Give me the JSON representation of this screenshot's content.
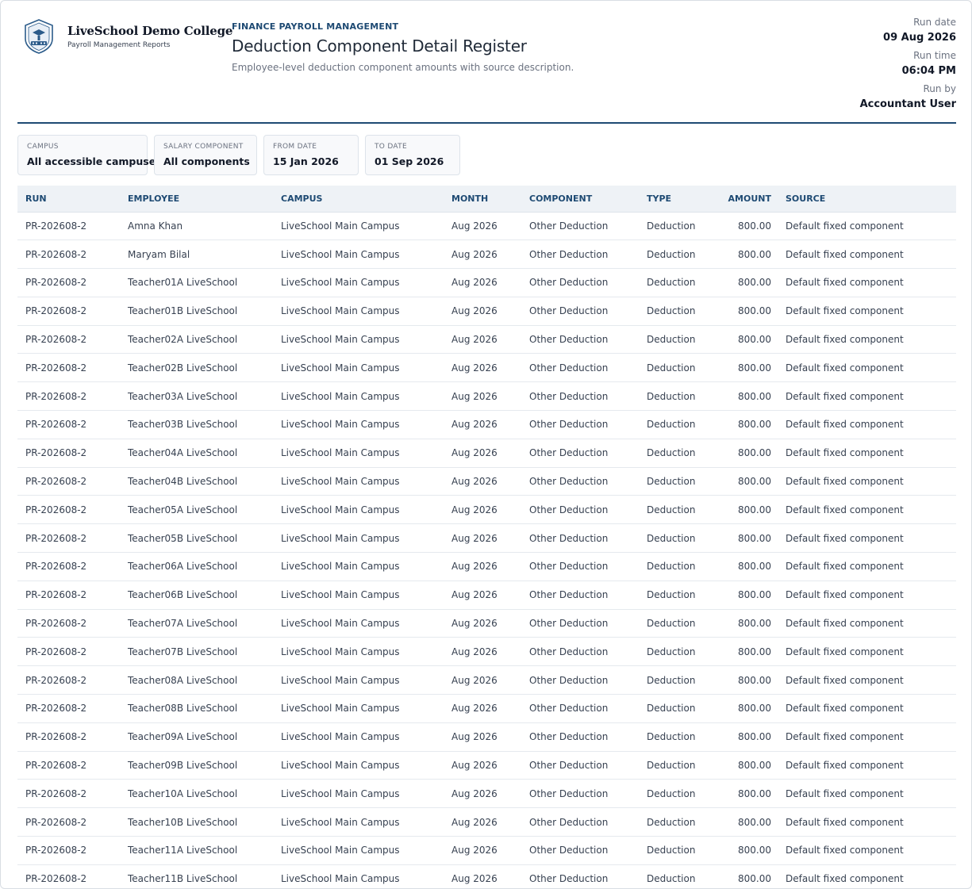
{
  "brand": {
    "college_name": "LiveSchool Demo College",
    "subtitle": "Payroll Management Reports",
    "logo_icon": "school-crest-icon"
  },
  "report": {
    "eyebrow": "FINANCE PAYROLL MANAGEMENT",
    "title": "Deduction Component Detail Register",
    "description": "Employee-level deduction component amounts with source description."
  },
  "meta": {
    "run_date_label": "Run date",
    "run_date": "09 Aug 2026",
    "run_time_label": "Run time",
    "run_time": "06:04 PM",
    "run_by_label": "Run by",
    "run_by": "Accountant User"
  },
  "filters": [
    {
      "label": "CAMPUS",
      "value": "All accessible campuses"
    },
    {
      "label": "SALARY COMPONENT",
      "value": "All components"
    },
    {
      "label": "FROM DATE",
      "value": "15 Jan 2026"
    },
    {
      "label": "TO DATE",
      "value": "01 Sep 2026"
    }
  ],
  "table": {
    "columns": [
      "RUN",
      "EMPLOYEE",
      "CAMPUS",
      "MONTH",
      "COMPONENT",
      "TYPE",
      "AMOUNT",
      "SOURCE"
    ],
    "rows": [
      [
        "PR-202608-2",
        "Amna Khan",
        "LiveSchool Main Campus",
        "Aug 2026",
        "Other Deduction",
        "Deduction",
        "800.00",
        "Default fixed component"
      ],
      [
        "PR-202608-2",
        "Maryam Bilal",
        "LiveSchool Main Campus",
        "Aug 2026",
        "Other Deduction",
        "Deduction",
        "800.00",
        "Default fixed component"
      ],
      [
        "PR-202608-2",
        "Teacher01A LiveSchool",
        "LiveSchool Main Campus",
        "Aug 2026",
        "Other Deduction",
        "Deduction",
        "800.00",
        "Default fixed component"
      ],
      [
        "PR-202608-2",
        "Teacher01B LiveSchool",
        "LiveSchool Main Campus",
        "Aug 2026",
        "Other Deduction",
        "Deduction",
        "800.00",
        "Default fixed component"
      ],
      [
        "PR-202608-2",
        "Teacher02A LiveSchool",
        "LiveSchool Main Campus",
        "Aug 2026",
        "Other Deduction",
        "Deduction",
        "800.00",
        "Default fixed component"
      ],
      [
        "PR-202608-2",
        "Teacher02B LiveSchool",
        "LiveSchool Main Campus",
        "Aug 2026",
        "Other Deduction",
        "Deduction",
        "800.00",
        "Default fixed component"
      ],
      [
        "PR-202608-2",
        "Teacher03A LiveSchool",
        "LiveSchool Main Campus",
        "Aug 2026",
        "Other Deduction",
        "Deduction",
        "800.00",
        "Default fixed component"
      ],
      [
        "PR-202608-2",
        "Teacher03B LiveSchool",
        "LiveSchool Main Campus",
        "Aug 2026",
        "Other Deduction",
        "Deduction",
        "800.00",
        "Default fixed component"
      ],
      [
        "PR-202608-2",
        "Teacher04A LiveSchool",
        "LiveSchool Main Campus",
        "Aug 2026",
        "Other Deduction",
        "Deduction",
        "800.00",
        "Default fixed component"
      ],
      [
        "PR-202608-2",
        "Teacher04B LiveSchool",
        "LiveSchool Main Campus",
        "Aug 2026",
        "Other Deduction",
        "Deduction",
        "800.00",
        "Default fixed component"
      ],
      [
        "PR-202608-2",
        "Teacher05A LiveSchool",
        "LiveSchool Main Campus",
        "Aug 2026",
        "Other Deduction",
        "Deduction",
        "800.00",
        "Default fixed component"
      ],
      [
        "PR-202608-2",
        "Teacher05B LiveSchool",
        "LiveSchool Main Campus",
        "Aug 2026",
        "Other Deduction",
        "Deduction",
        "800.00",
        "Default fixed component"
      ],
      [
        "PR-202608-2",
        "Teacher06A LiveSchool",
        "LiveSchool Main Campus",
        "Aug 2026",
        "Other Deduction",
        "Deduction",
        "800.00",
        "Default fixed component"
      ],
      [
        "PR-202608-2",
        "Teacher06B LiveSchool",
        "LiveSchool Main Campus",
        "Aug 2026",
        "Other Deduction",
        "Deduction",
        "800.00",
        "Default fixed component"
      ],
      [
        "PR-202608-2",
        "Teacher07A LiveSchool",
        "LiveSchool Main Campus",
        "Aug 2026",
        "Other Deduction",
        "Deduction",
        "800.00",
        "Default fixed component"
      ],
      [
        "PR-202608-2",
        "Teacher07B LiveSchool",
        "LiveSchool Main Campus",
        "Aug 2026",
        "Other Deduction",
        "Deduction",
        "800.00",
        "Default fixed component"
      ],
      [
        "PR-202608-2",
        "Teacher08A LiveSchool",
        "LiveSchool Main Campus",
        "Aug 2026",
        "Other Deduction",
        "Deduction",
        "800.00",
        "Default fixed component"
      ],
      [
        "PR-202608-2",
        "Teacher08B LiveSchool",
        "LiveSchool Main Campus",
        "Aug 2026",
        "Other Deduction",
        "Deduction",
        "800.00",
        "Default fixed component"
      ],
      [
        "PR-202608-2",
        "Teacher09A LiveSchool",
        "LiveSchool Main Campus",
        "Aug 2026",
        "Other Deduction",
        "Deduction",
        "800.00",
        "Default fixed component"
      ],
      [
        "PR-202608-2",
        "Teacher09B LiveSchool",
        "LiveSchool Main Campus",
        "Aug 2026",
        "Other Deduction",
        "Deduction",
        "800.00",
        "Default fixed component"
      ],
      [
        "PR-202608-2",
        "Teacher10A LiveSchool",
        "LiveSchool Main Campus",
        "Aug 2026",
        "Other Deduction",
        "Deduction",
        "800.00",
        "Default fixed component"
      ],
      [
        "PR-202608-2",
        "Teacher10B LiveSchool",
        "LiveSchool Main Campus",
        "Aug 2026",
        "Other Deduction",
        "Deduction",
        "800.00",
        "Default fixed component"
      ],
      [
        "PR-202608-2",
        "Teacher11A LiveSchool",
        "LiveSchool Main Campus",
        "Aug 2026",
        "Other Deduction",
        "Deduction",
        "800.00",
        "Default fixed component"
      ],
      [
        "PR-202608-2",
        "Teacher11B LiveSchool",
        "LiveSchool Main Campus",
        "Aug 2026",
        "Other Deduction",
        "Deduction",
        "800.00",
        "Default fixed component"
      ]
    ]
  },
  "colors": {
    "accent": "#1e4a73",
    "header_bg": "#eef2f6",
    "filter_bg": "#f8f9fb"
  }
}
